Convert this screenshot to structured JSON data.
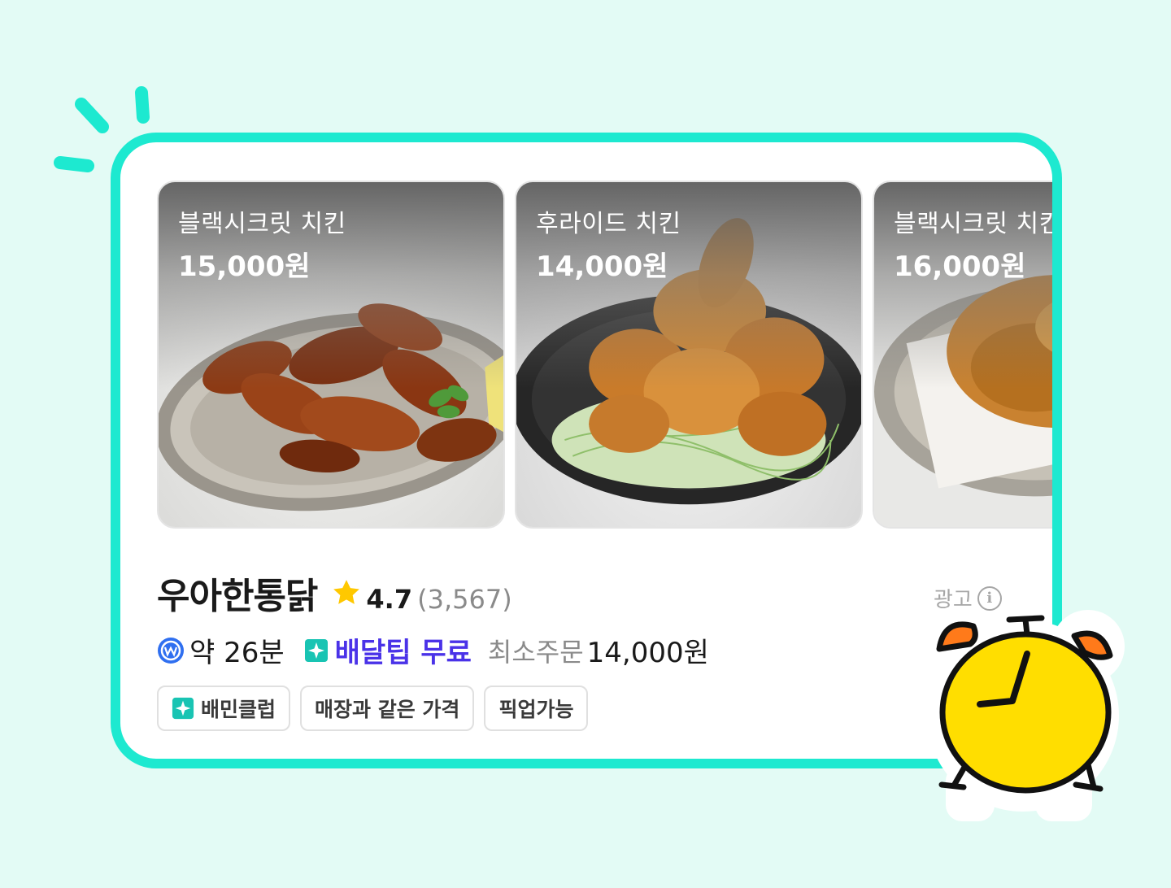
{
  "colors": {
    "background": "#e3fbf5",
    "card_border": "#1de9d0",
    "free_tip": "#4a32e8",
    "star": "#ffc800",
    "clock_face": "#ffde00",
    "clock_bells": "#ff7a1a"
  },
  "menu_items": [
    {
      "name": "블랙시크릿 치킨",
      "price": "15,000원"
    },
    {
      "name": "후라이드 치킨",
      "price": "14,000원"
    },
    {
      "name": "블랙시크릿 치킨",
      "price": "16,000원"
    }
  ],
  "store": {
    "name": "우아한통닭",
    "rating": "4.7",
    "reviews": "(3,567)",
    "ad_label": "광고",
    "eta": "약 26분",
    "delivery_tip": "배달팁 무료",
    "min_order_label": "최소주문",
    "min_order_value": "14,000원"
  },
  "tags": [
    "배민클럽",
    "매장과 같은 가격",
    "픽업가능"
  ],
  "icons": [
    "star-icon",
    "info-icon",
    "won-coin-icon",
    "baemin-club-icon",
    "alarm-clock-icon"
  ]
}
